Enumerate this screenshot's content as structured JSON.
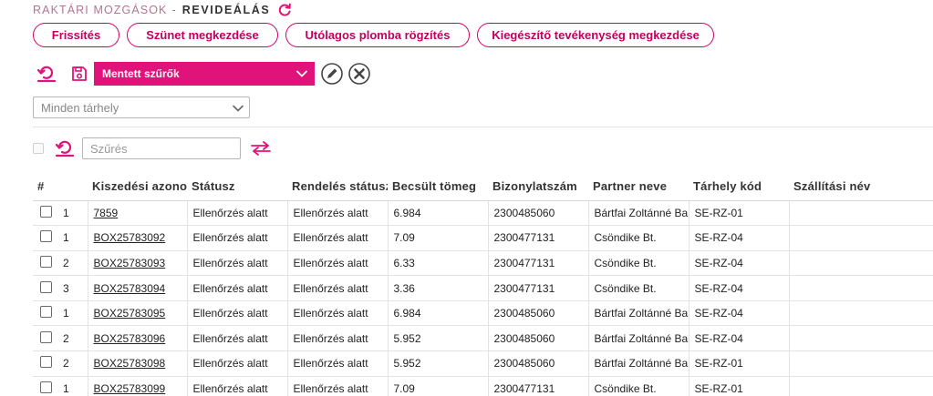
{
  "breadcrumb": {
    "parent": "Raktári mozgások",
    "separator": "-",
    "current": "Revideálás"
  },
  "actions": [
    {
      "label": "Frissítés"
    },
    {
      "label": "Szünet megkezdése"
    },
    {
      "label": "Utólagos plomba rögzítés"
    },
    {
      "label": "Kiegészítő tevékenység megkezdése"
    }
  ],
  "saved_filters": {
    "selected": "Mentett szűrők"
  },
  "storage_filter": {
    "selected": "Minden tárhely"
  },
  "grid": {
    "search_placeholder": "Szűrés",
    "columns": [
      {
        "label": "#"
      },
      {
        "label": "Kiszedési azonosító"
      },
      {
        "label": "Státusz"
      },
      {
        "label": "Rendelés státusz"
      },
      {
        "label": "Becsült tömeg"
      },
      {
        "label": "Bizonylatszám"
      },
      {
        "label": "Partner neve"
      },
      {
        "label": "Tárhely kód"
      },
      {
        "label": "Szállítási név"
      }
    ],
    "rows": [
      {
        "count": "1",
        "id": "7859",
        "status": "Ellenőrzés alatt",
        "order_status": "Ellenőrzés alatt",
        "weight": "6.984",
        "doc": "2300485060",
        "partner": "Bártfai Zoltánné Bartfai",
        "storage": "SE-RZ-01",
        "shipping": ""
      },
      {
        "count": "1",
        "id": "BOX25783092",
        "status": "Ellenőrzés alatt",
        "order_status": "Ellenőrzés alatt",
        "weight": "7.09",
        "doc": "2300477131",
        "partner": "Csöndike Bt.",
        "storage": "SE-RZ-04",
        "shipping": ""
      },
      {
        "count": "2",
        "id": "BOX25783093",
        "status": "Ellenőrzés alatt",
        "order_status": "Ellenőrzés alatt",
        "weight": "6.33",
        "doc": "2300477131",
        "partner": "Csöndike Bt.",
        "storage": "SE-RZ-04",
        "shipping": ""
      },
      {
        "count": "3",
        "id": "BOX25783094",
        "status": "Ellenőrzés alatt",
        "order_status": "Ellenőrzés alatt",
        "weight": "3.36",
        "doc": "2300477131",
        "partner": "Csöndike Bt.",
        "storage": "SE-RZ-04",
        "shipping": ""
      },
      {
        "count": "1",
        "id": "BOX25783095",
        "status": "Ellenőrzés alatt",
        "order_status": "Ellenőrzés alatt",
        "weight": "6.984",
        "doc": "2300485060",
        "partner": "Bártfai Zoltánné Bartfai",
        "storage": "SE-RZ-04",
        "shipping": ""
      },
      {
        "count": "2",
        "id": "BOX25783096",
        "status": "Ellenőrzés alatt",
        "order_status": "Ellenőrzés alatt",
        "weight": "5.952",
        "doc": "2300485060",
        "partner": "Bártfai Zoltánné Bartfai",
        "storage": "SE-RZ-04",
        "shipping": ""
      },
      {
        "count": "2",
        "id": "BOX25783098",
        "status": "Ellenőrzés alatt",
        "order_status": "Ellenőrzés alatt",
        "weight": "5.952",
        "doc": "2300485060",
        "partner": "Bártfai Zoltánné Bartfai",
        "storage": "SE-RZ-01",
        "shipping": ""
      },
      {
        "count": "1",
        "id": "BOX25783099",
        "status": "Ellenőrzés alatt",
        "order_status": "Ellenőrzés alatt",
        "weight": "7.09",
        "doc": "2300477131",
        "partner": "Csöndike Bt.",
        "storage": "SE-RZ-01",
        "shipping": ""
      }
    ]
  },
  "colors": {
    "accent": "#e0137a",
    "accent_dark": "#c2005f",
    "breadcrumb_parent": "#b27494"
  },
  "icons": {
    "breadcrumb_refresh": "refresh-icon",
    "reset": "reset-filter-icon",
    "save": "save-icon",
    "edit": "pencil-icon",
    "delete": "close-icon",
    "swap": "swap-arrows-icon",
    "dropdown": "chevron-down-icon"
  }
}
